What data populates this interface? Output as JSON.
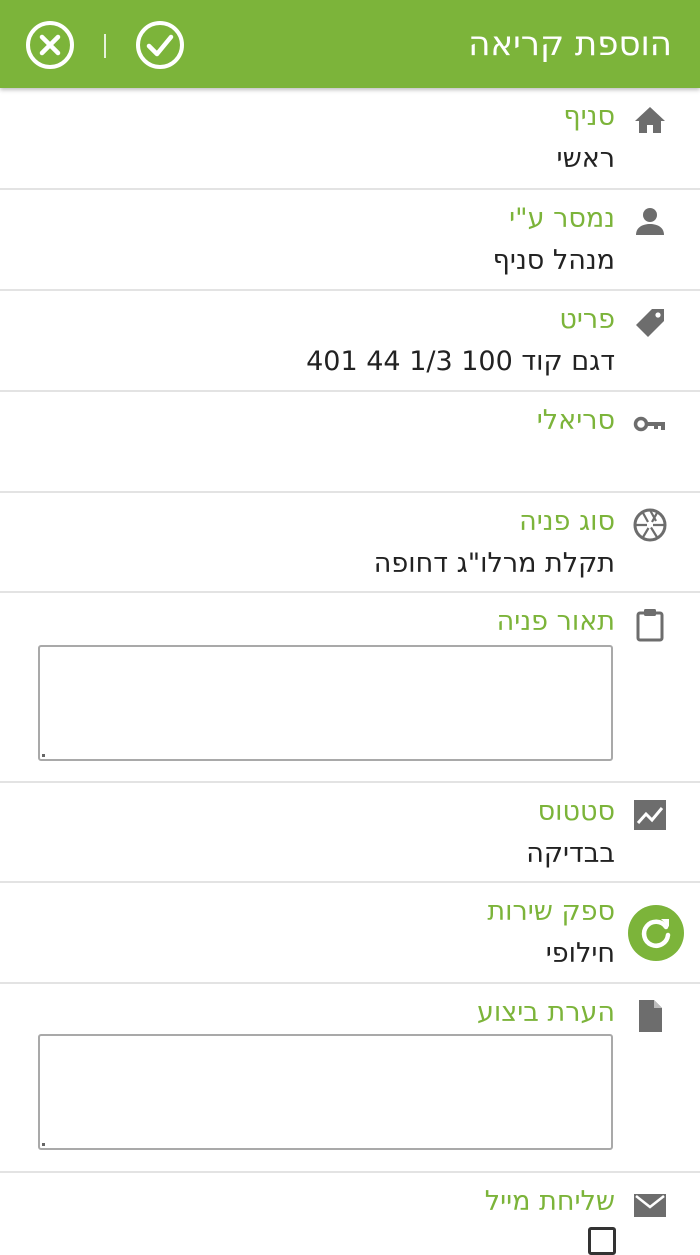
{
  "header": {
    "title": "הוספת קריאה",
    "save_icon": "check-circle-icon",
    "cancel_icon": "close-circle-icon",
    "background_color": "#7cb43a"
  },
  "fields": {
    "branch": {
      "label": "סניף",
      "value": "ראשי",
      "icon": "home-icon"
    },
    "delivered_by": {
      "label": "נמסר ע\"י",
      "value": "מנהל סניף",
      "icon": "person-icon"
    },
    "item": {
      "label": "פריט",
      "value": "דגם קוד 100 1/3 44 401",
      "icon": "tag-icon"
    },
    "serial": {
      "label": "סריאלי",
      "value": "",
      "icon": "key-icon"
    },
    "request_type": {
      "label": "סוג פניה",
      "value": "תקלת מרלו\"ג דחופה",
      "icon": "aperture-icon"
    },
    "request_description": {
      "label": "תאור פניה",
      "value": "",
      "icon": "clipboard-icon"
    },
    "status": {
      "label": "סטטוס",
      "value": "בבדיקה",
      "icon": "trend-chart-icon"
    },
    "service_provider": {
      "label": "ספק שירות",
      "value": "חילופי",
      "icon": "refresh-icon"
    },
    "execution_note": {
      "label": "הערת ביצוע",
      "value": "",
      "icon": "document-icon"
    },
    "send_mail": {
      "label": "שליחת מייל",
      "checked": false,
      "icon": "mail-icon"
    }
  }
}
